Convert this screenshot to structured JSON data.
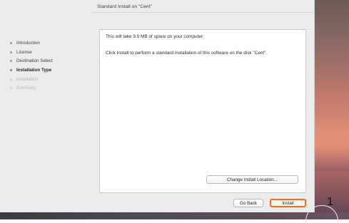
{
  "window": {
    "title": "Standard Install on \"Cent\""
  },
  "sidebar": {
    "steps": [
      {
        "label": "Introduction"
      },
      {
        "label": "License"
      },
      {
        "label": "Destination Select"
      },
      {
        "label": "Installation Type"
      },
      {
        "label": "Installation"
      },
      {
        "label": "Summary"
      }
    ]
  },
  "content": {
    "space_message": "This will take 9.9 MB of space on your computer.",
    "install_message": "Click Install to perform a standard installation of this software on the disk \"Cent\"."
  },
  "buttons": {
    "change_location": "Change Install Location...",
    "go_back": "Go Back",
    "install": "Install"
  },
  "annotation": {
    "callout_number": "1",
    "highlight_color": "#ff6a1a"
  }
}
